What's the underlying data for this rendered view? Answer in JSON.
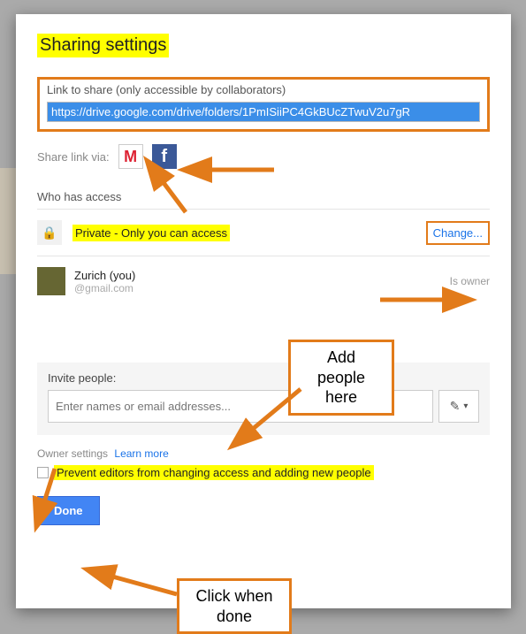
{
  "dialog": {
    "title": "Sharing settings",
    "link_label": "Link to share (only accessible by collaborators)",
    "link_value": "https://drive.google.com/drive/folders/1PmISiiPC4GkBUcZTwuV2u7gR",
    "share_via_label": "Share link via:",
    "who_has_access": "Who has access",
    "private_label": "Private - Only you can access",
    "change_label": "Change...",
    "owner": {
      "name": "Zurich (you)",
      "email_shown": "@gmail.com",
      "role": "Is owner"
    },
    "invite_label": "Invite people:",
    "invite_placeholder": "Enter names or email addresses...",
    "owner_settings_label": "Owner settings",
    "learn_more": "Learn more",
    "prevent_label": "Prevent editors from changing access and adding new people",
    "done_label": "Done"
  },
  "annotations": {
    "add_people": "Add people\nhere",
    "click_done": "Click when\ndone"
  },
  "colors": {
    "highlight": "#ffff00",
    "accent_orange": "#e27b1a",
    "link_blue": "#1a73e8",
    "button_blue": "#4285f4"
  }
}
